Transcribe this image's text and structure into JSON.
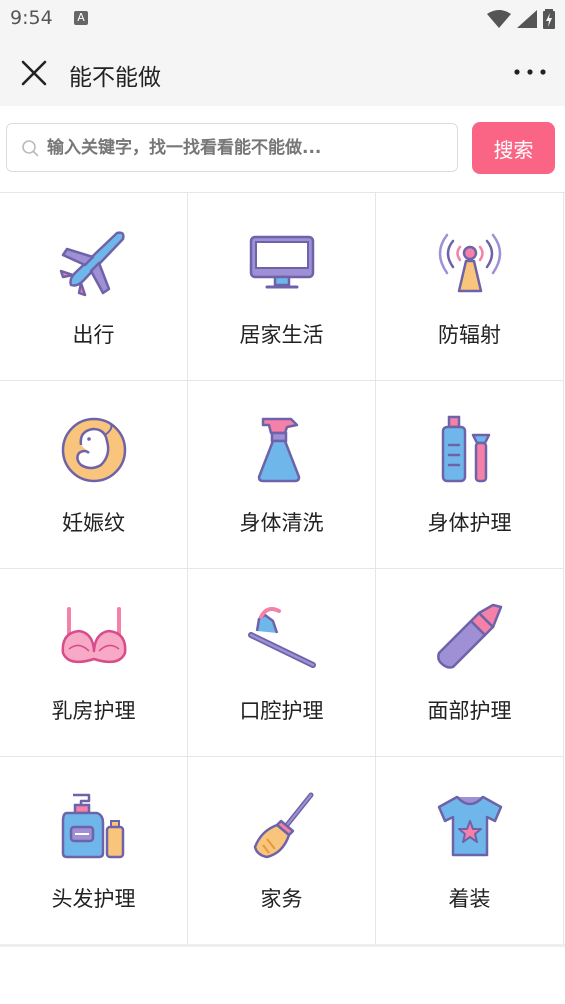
{
  "status_bar": {
    "time": "9:54",
    "notification_letter": "A"
  },
  "header": {
    "title": "能不能做"
  },
  "search": {
    "placeholder": "输入关键字，找一找看看能不能做...",
    "button_label": "搜索"
  },
  "colors": {
    "accent": "#fa6586",
    "icon_stroke": "#6e63a8"
  },
  "categories": [
    {
      "label": "出行",
      "icon": "airplane-icon"
    },
    {
      "label": "居家生活",
      "icon": "monitor-icon"
    },
    {
      "label": "防辐射",
      "icon": "radiation-antenna-icon"
    },
    {
      "label": "妊娠纹",
      "icon": "fetus-icon"
    },
    {
      "label": "身体清洗",
      "icon": "spray-bottle-icon"
    },
    {
      "label": "身体护理",
      "icon": "lotion-bottles-icon"
    },
    {
      "label": "乳房护理",
      "icon": "bra-icon"
    },
    {
      "label": "口腔护理",
      "icon": "toothbrush-icon"
    },
    {
      "label": "面部护理",
      "icon": "lipstick-icon"
    },
    {
      "label": "头发护理",
      "icon": "shampoo-icon"
    },
    {
      "label": "家务",
      "icon": "broom-icon"
    },
    {
      "label": "着装",
      "icon": "tshirt-icon"
    }
  ]
}
